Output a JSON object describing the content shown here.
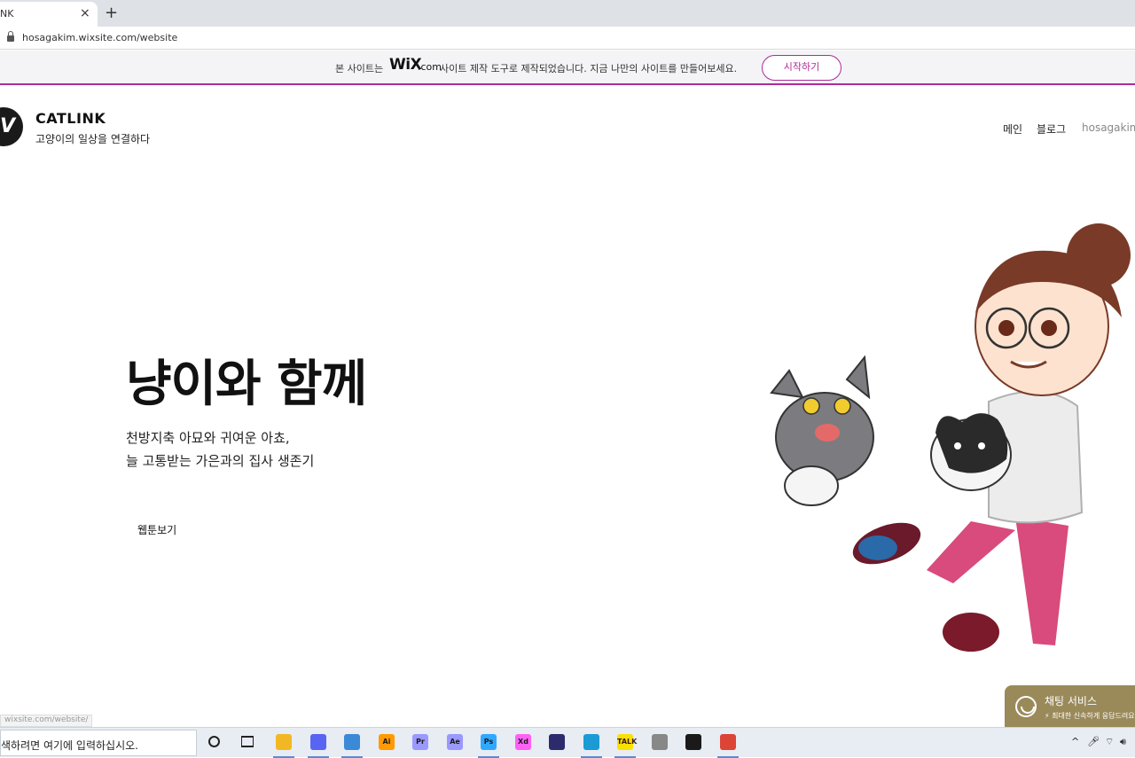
{
  "browser": {
    "tab_title": "NK",
    "tab_close": "×",
    "new_tab": "+",
    "url": "hosagakim.wixsite.com/website"
  },
  "wix_banner": {
    "text_before": "본 사이트는",
    "logo": "WiX",
    "logo_domain": ".com",
    "text_after": "사이트 제작 도구로 제작되었습니다. 지금 나만의 사이트를 만들어보세요.",
    "start_button": "시작하기",
    "accent_color": "#b02a9a"
  },
  "site": {
    "logo_letter": "V",
    "title": "CATLINK",
    "tagline": "고양이의 일상을 연결하다",
    "nav": [
      "메인",
      "블로그",
      "hosagakim"
    ]
  },
  "hero": {
    "title": "냥이와 함께",
    "line1": "천방지축 아묘와 귀여운 아쵸,",
    "line2": "늘 고통받는 가은과의  집사 생존기",
    "button": "웹툰보기"
  },
  "chat": {
    "title": "채팅 서비스",
    "subtitle": "⚡ 최대한 신속하게 응답드려요"
  },
  "status_bar_url": "wixsite.com/website/",
  "taskbar": {
    "search_placeholder": "색하려면 여기에 입력하십시오.",
    "apps": [
      {
        "name": "file-explorer",
        "label": "",
        "color": "#f2b824"
      },
      {
        "name": "discord",
        "label": "",
        "color": "#5865f2"
      },
      {
        "name": "photos",
        "label": "",
        "color": "#3a8ad8"
      },
      {
        "name": "illustrator",
        "label": "Ai",
        "color": "#ff9a00"
      },
      {
        "name": "premiere",
        "label": "Pr",
        "color": "#9999ff"
      },
      {
        "name": "after-effects",
        "label": "Ae",
        "color": "#9999ff"
      },
      {
        "name": "photoshop",
        "label": "Ps",
        "color": "#31a8ff"
      },
      {
        "name": "xd",
        "label": "Xd",
        "color": "#ff61f6"
      },
      {
        "name": "notebook",
        "label": "",
        "color": "#2d2b6b"
      },
      {
        "name": "edge",
        "label": "",
        "color": "#1c9ad6"
      },
      {
        "name": "kakaotalk",
        "label": "TALK",
        "color": "#fae100"
      },
      {
        "name": "microphone-app",
        "label": "",
        "color": "#888888"
      },
      {
        "name": "sticky-notes",
        "label": "",
        "color": "#1a1a1a"
      },
      {
        "name": "chrome",
        "label": "",
        "color": "#db4437"
      }
    ],
    "tray": "^"
  }
}
